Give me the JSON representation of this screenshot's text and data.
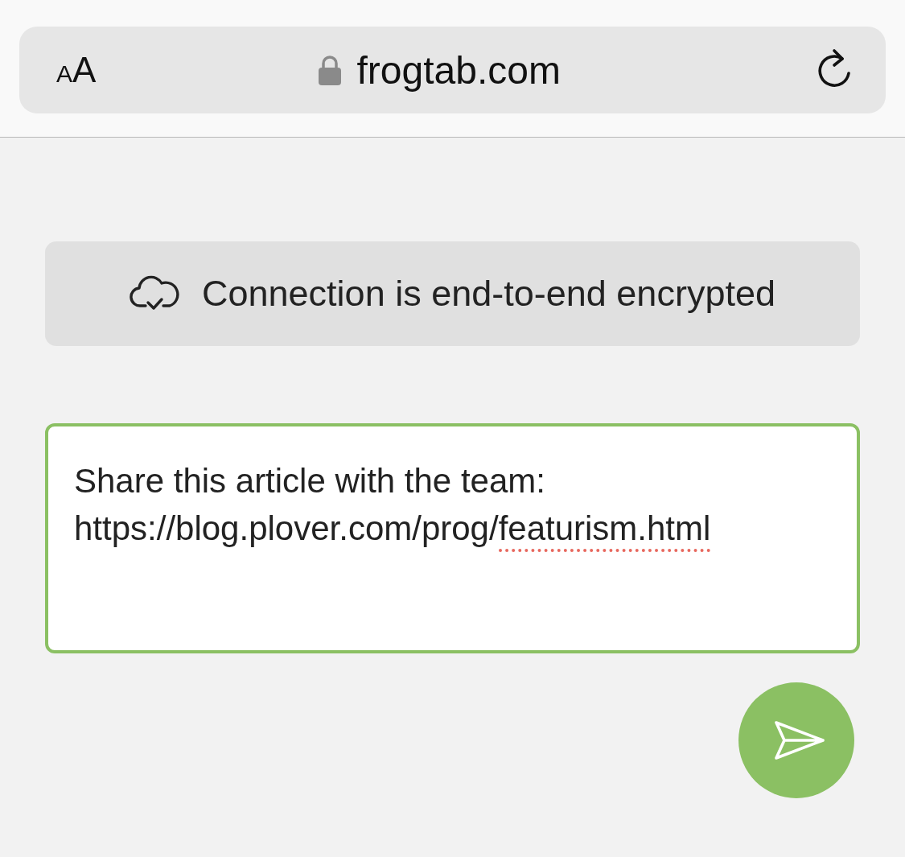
{
  "address_bar": {
    "text_size_small": "A",
    "text_size_large": "A",
    "secure": true,
    "domain": "frogtab.com"
  },
  "banner": {
    "text": "Connection is end-to-end encrypted"
  },
  "message": {
    "focused": true,
    "parts": [
      {
        "text": "Share this article with the team:\nhttps://blog.plover.com/prog/",
        "misspelled": false
      },
      {
        "text": "featurism.html",
        "misspelled": true
      }
    ]
  }
}
